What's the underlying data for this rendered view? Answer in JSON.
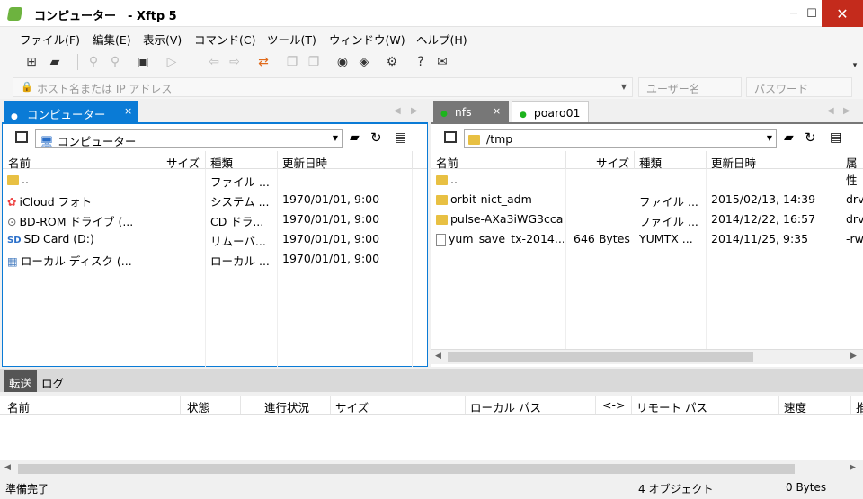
{
  "window": {
    "title": "コンピューター　- Xftp 5",
    "minimize": "─",
    "maximize": "☐",
    "close": "✕"
  },
  "menu": [
    "ファイル(F)",
    "編集(E)",
    "表示(V)",
    "コマンド(C)",
    "ツール(T)",
    "ウィンドウ(W)",
    "ヘルプ(H)"
  ],
  "address": {
    "host_placeholder": "ホスト名または IP アドレス",
    "user_placeholder": "ユーザー名",
    "password_placeholder": "パスワード"
  },
  "left": {
    "tab": "コンピューター",
    "tab_close": "×",
    "path": "コンピューター",
    "columns": [
      "名前",
      "サイズ",
      "種類",
      "更新日時"
    ],
    "rows": [
      {
        "name": "..",
        "size": "",
        "type": "ファイル ...",
        "date": "",
        "icon": "folder-icon"
      },
      {
        "name": "iCloud フォト",
        "size": "",
        "type": "システム ...",
        "date": "1970/01/01, 9:00",
        "icon": "icloud-icon"
      },
      {
        "name": "BD-ROM ドライブ (...",
        "size": "",
        "type": "CD ドラ...",
        "date": "1970/01/01, 9:00",
        "icon": "disc-drive-icon"
      },
      {
        "name": "SD Card (D:)",
        "size": "",
        "type": "リムーバ...",
        "date": "1970/01/01, 9:00",
        "icon": "sd-card-icon"
      },
      {
        "name": "ローカル ディスク (...",
        "size": "",
        "type": "ローカル ...",
        "date": "1970/01/01, 9:00",
        "icon": "local-disk-icon"
      }
    ]
  },
  "right": {
    "tabs": [
      "nfs",
      "poaro01"
    ],
    "active_tab_close": "×",
    "path": "/tmp",
    "columns": [
      "名前",
      "サイズ",
      "種類",
      "更新日時",
      "属性"
    ],
    "rows": [
      {
        "name": "..",
        "size": "",
        "type": "",
        "date": "",
        "attr": "",
        "icon": "folder-icon"
      },
      {
        "name": "orbit-nict_adm",
        "size": "",
        "type": "ファイル ...",
        "date": "2015/02/13, 14:39",
        "attr": "drv",
        "icon": "folder-icon"
      },
      {
        "name": "pulse-AXa3iWG3ccaK",
        "size": "",
        "type": "ファイル ...",
        "date": "2014/12/22, 16:57",
        "attr": "drv",
        "icon": "folder-icon"
      },
      {
        "name": "yum_save_tx-2014...",
        "size": "646 Bytes",
        "type": "YUMTX ...",
        "date": "2014/11/25, 9:35",
        "attr": "-rw",
        "icon": "file-icon"
      }
    ]
  },
  "bottom": {
    "tabs": [
      "転送",
      "ログ"
    ],
    "columns": [
      "名前",
      "状態",
      "進行状況",
      "サイズ",
      "ローカル パス",
      "<->",
      "リモート パス",
      "速度",
      "推"
    ]
  },
  "status": {
    "left": "準備完了",
    "objects": "4 オブジェクト",
    "bytes": "0 Bytes"
  },
  "colors": {
    "accent": "#0a7bd6",
    "connected": "#1db31d",
    "close": "#c42b1c"
  }
}
